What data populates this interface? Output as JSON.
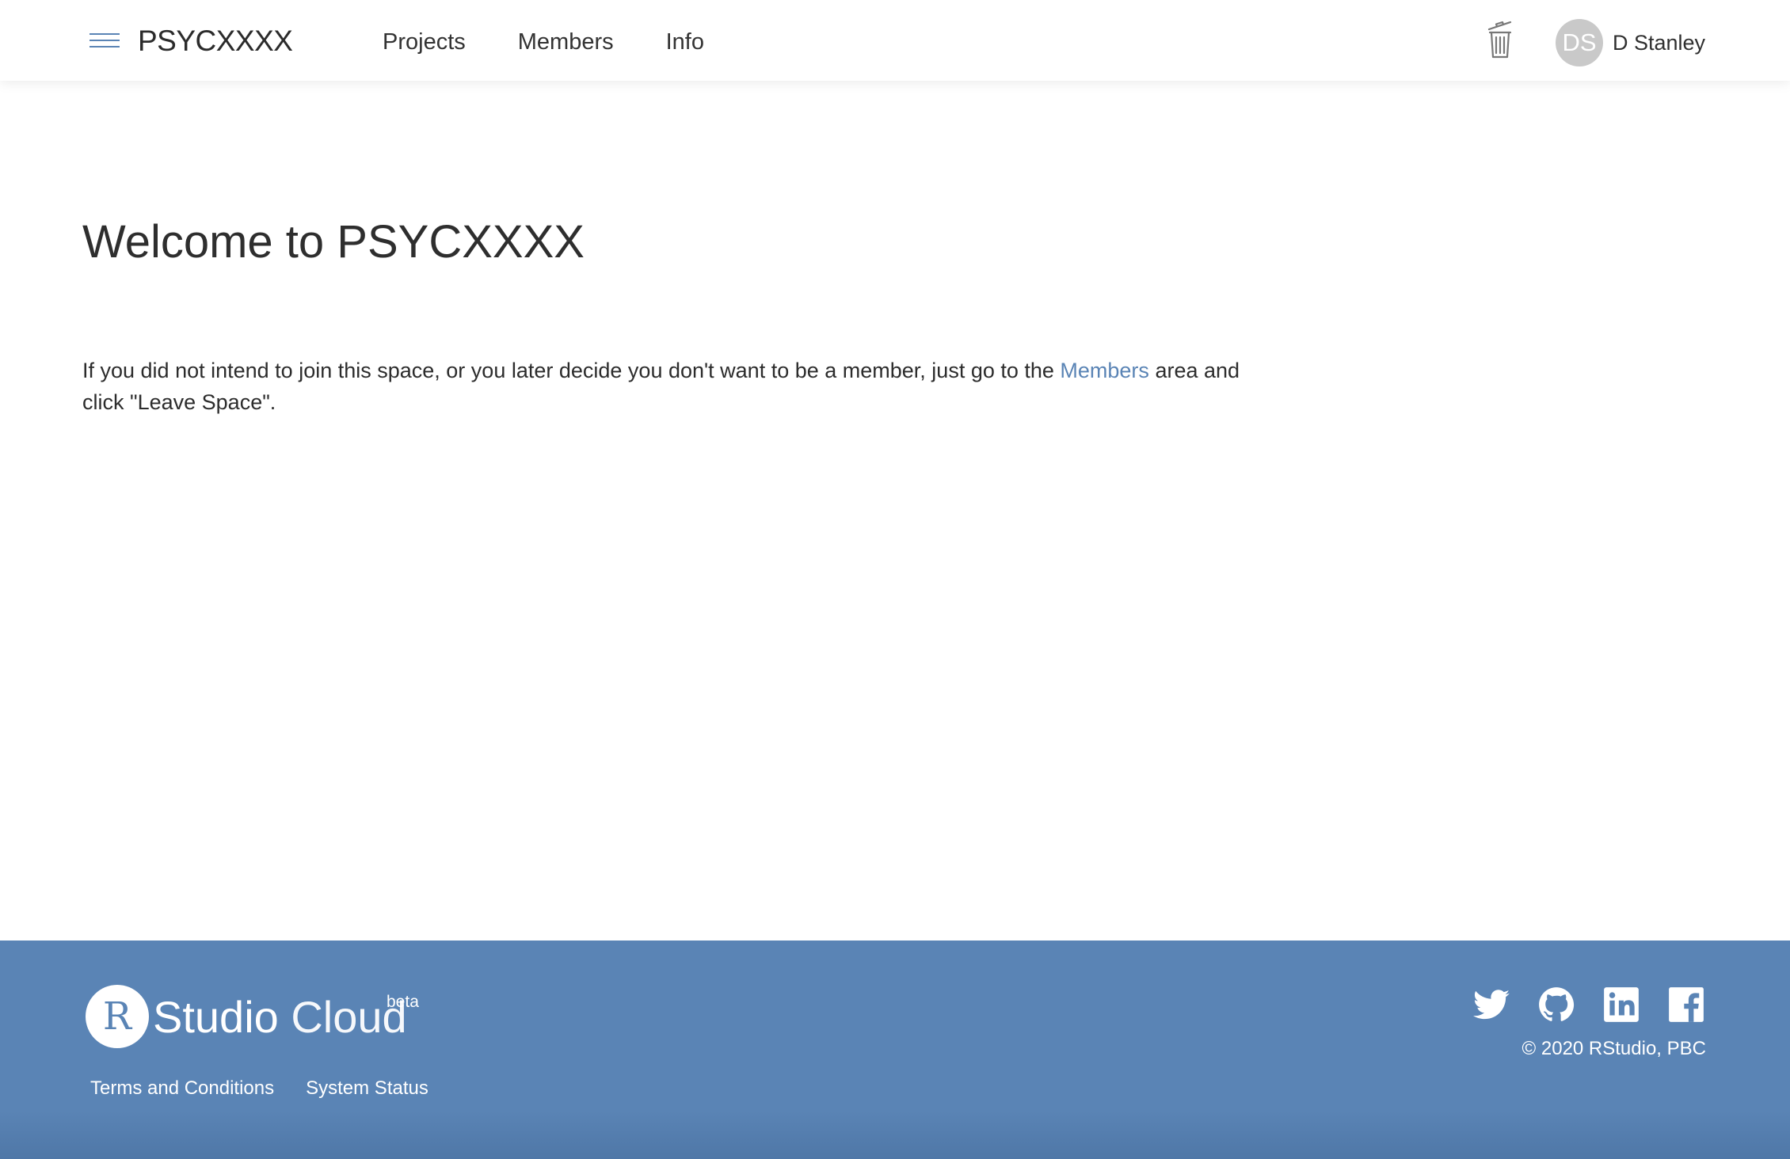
{
  "header": {
    "menu_icon": "hamburger-menu-icon",
    "space_name": "PSYCXXXX",
    "nav": [
      {
        "label": "Projects"
      },
      {
        "label": "Members"
      },
      {
        "label": "Info"
      }
    ],
    "trash_icon": "trash-icon",
    "user": {
      "initials": "DS",
      "name": "D Stanley"
    }
  },
  "main": {
    "heading": "Welcome to PSYCXXXX",
    "message_before_link": "If you did not intend to join this space, or you later decide you don't want to be a member, just go to the ",
    "members_link": "Members",
    "message_after_link": " area and click \"Leave Space\"."
  },
  "footer": {
    "logo_letter": "R",
    "brand_studio": "Studio",
    "brand_cloud": "Cloud",
    "beta": "beta",
    "links": [
      {
        "label": "Terms and Conditions"
      },
      {
        "label": "System Status"
      }
    ],
    "social_icons": [
      "twitter-icon",
      "github-icon",
      "linkedin-icon",
      "facebook-icon"
    ],
    "copyright": "© 2020 RStudio, PBC"
  },
  "colors": {
    "accent": "#5a84b5",
    "footer_bg": "#5a84b5",
    "avatar_bg": "#c9c9c9",
    "text": "#2d2d2d"
  }
}
